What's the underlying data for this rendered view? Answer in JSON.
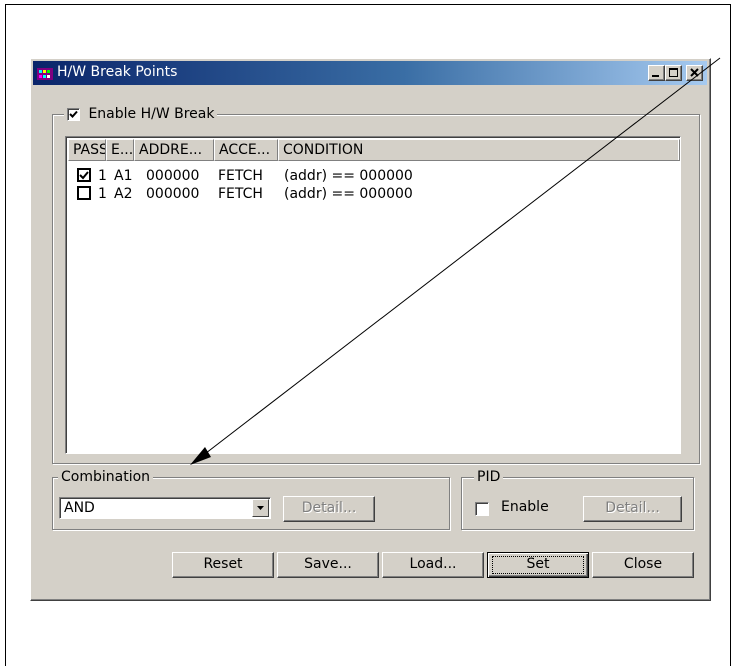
{
  "window": {
    "title": "H/W Break Points",
    "controls": [
      "minimize-icon",
      "maximize-icon",
      "close-icon"
    ]
  },
  "enable_group": {
    "checkbox_label": "Enable H/W Break",
    "checked": true
  },
  "breakpoint_list": {
    "columns": [
      "PASS",
      "E...",
      "ADDRE...",
      "ACCE...",
      "CONDITION"
    ],
    "rows": [
      {
        "checked": true,
        "pass": "1",
        "event": "A1",
        "address": "000000",
        "access": "FETCH",
        "condition": "(addr) == 000000"
      },
      {
        "checked": false,
        "pass": "1",
        "event": "A2",
        "address": "000000",
        "access": "FETCH",
        "condition": "(addr) == 000000"
      }
    ]
  },
  "combination": {
    "legend": "Combination",
    "selected": "AND",
    "detail_label": "Detail..."
  },
  "pid": {
    "legend": "PID",
    "enable_label": "Enable",
    "enable_checked": false,
    "detail_label": "Detail..."
  },
  "buttons": {
    "reset": "Reset",
    "save": "Save...",
    "load": "Load...",
    "set": "Set",
    "close": "Close"
  },
  "colors": {
    "dialog_face": "#d4d0c8",
    "title_start": "#0a246a",
    "title_end": "#a6caf0"
  }
}
